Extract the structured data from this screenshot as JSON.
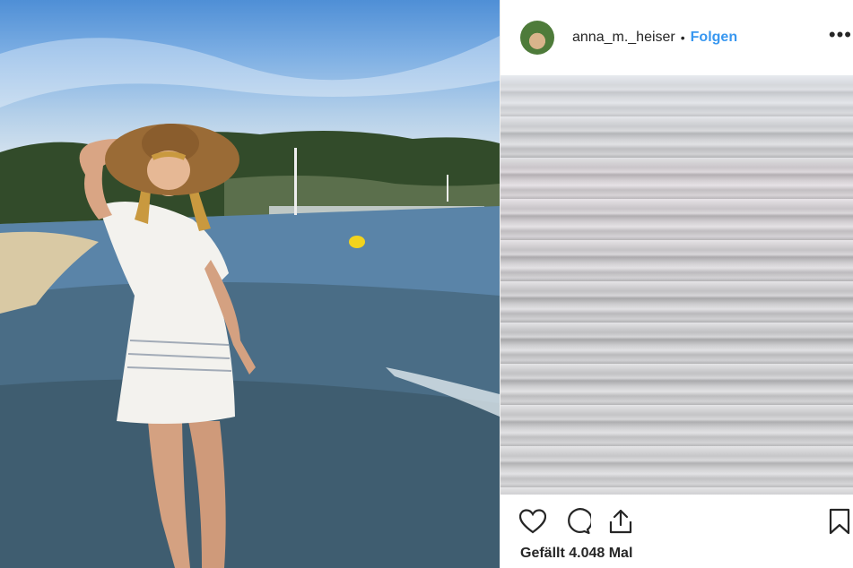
{
  "post": {
    "username": "anna_m._heiser",
    "separator": "•",
    "follow_label": "Folgen",
    "more_label": "•••",
    "likes_text": "Gefällt 4.048 Mal"
  },
  "icons": {
    "like": "heart-icon",
    "comment": "comment-icon",
    "share": "share-icon",
    "save": "bookmark-icon",
    "more": "more-options-icon"
  },
  "colors": {
    "accent": "#3897f0",
    "text": "#262626"
  }
}
